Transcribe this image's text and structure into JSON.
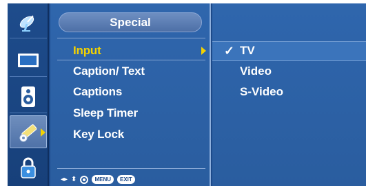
{
  "menu": {
    "title": "Special",
    "items": [
      {
        "label": "Input",
        "selected": true
      },
      {
        "label": "Caption/ Text",
        "selected": false
      },
      {
        "label": "Captions",
        "selected": false
      },
      {
        "label": "Sleep Timer",
        "selected": false
      },
      {
        "label": "Key Lock",
        "selected": false
      }
    ]
  },
  "submenu": {
    "options": [
      {
        "label": "TV",
        "checked": true
      },
      {
        "label": "Video",
        "checked": false
      },
      {
        "label": "S-Video",
        "checked": false
      }
    ]
  },
  "sidebar": {
    "icons": [
      "satellite-dish-icon",
      "screen-icon",
      "speaker-icon",
      "special-tools-icon",
      "lock-icon"
    ],
    "active_index": 3
  },
  "footer": {
    "menu_label": "MENU",
    "exit_label": "EXIT"
  },
  "colors": {
    "background": "#1d4a8a",
    "selected_text": "#f3d200",
    "text": "#ffffff"
  }
}
